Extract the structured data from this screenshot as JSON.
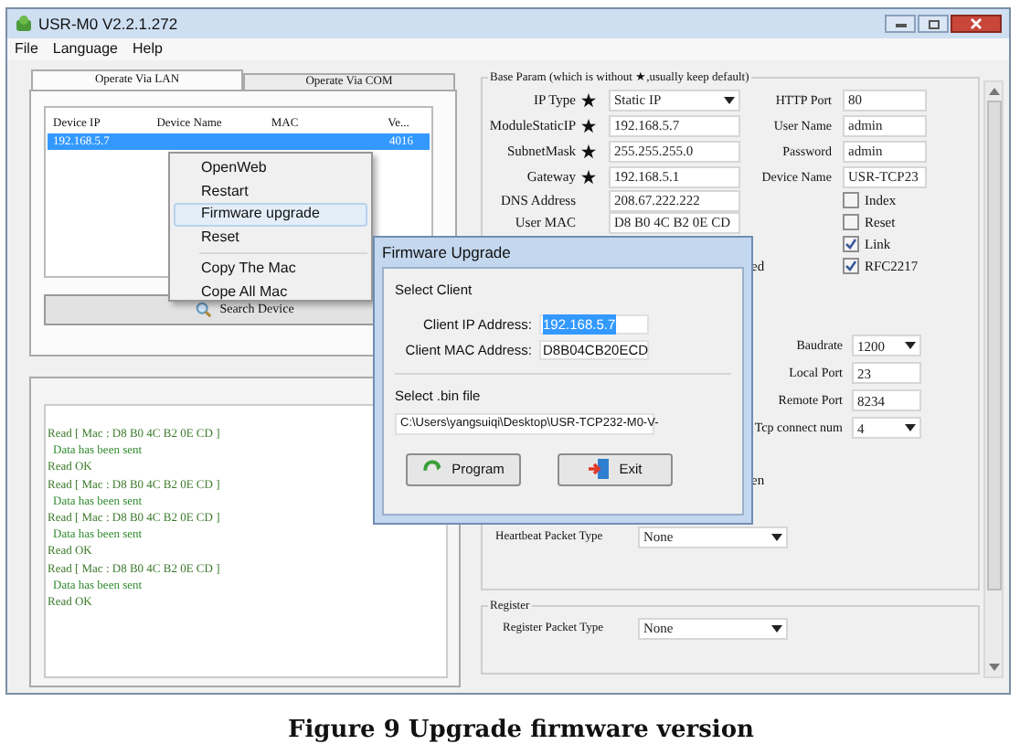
{
  "window": {
    "title": "USR-M0 V2.2.1.272"
  },
  "menu_bar": [
    "File",
    "Language",
    "Help"
  ],
  "tabs": [
    {
      "label": "Operate Via LAN",
      "selected": true
    },
    {
      "label": "Operate Via COM",
      "selected": false
    }
  ],
  "device_table": {
    "columns": [
      "Device IP",
      "Device Name",
      "MAC",
      "Ve..."
    ],
    "rows": [
      {
        "device_ip": "192.168.5.7",
        "version": "4016",
        "selected": true
      }
    ]
  },
  "search_button": "Search Device",
  "log": [
    {
      "text": "Read [ Mac : D8 B0 4C B2 0E CD ]",
      "kind": "request"
    },
    {
      "text": "Data has been sent",
      "kind": "reply"
    },
    {
      "text": "Read OK",
      "kind": "request"
    },
    {
      "text": "Read [ Mac : D8 B0 4C B2 0E CD ]",
      "kind": "request"
    },
    {
      "text": "Data has been sent",
      "kind": "reply"
    },
    {
      "text": "Read [ Mac : D8 B0 4C B2 0E CD ]",
      "kind": "request"
    },
    {
      "text": "Data has been sent",
      "kind": "reply"
    },
    {
      "text": "Read OK",
      "kind": "request"
    },
    {
      "text": "Read [ Mac : D8 B0 4C B2 0E CD ]",
      "kind": "request"
    },
    {
      "text": "Data has been sent",
      "kind": "reply"
    },
    {
      "text": "Read OK",
      "kind": "request"
    }
  ],
  "base_params": {
    "title": "Base Param (which is without ★,usually keep default)",
    "left_fields": [
      {
        "label": "IP Type",
        "required": true,
        "value": "Static IP",
        "kind": "select"
      },
      {
        "label": "ModuleStaticIP",
        "required": true,
        "value": "192.168.5.7",
        "kind": "text"
      },
      {
        "label": "SubnetMask",
        "required": true,
        "value": "255.255.255.0",
        "kind": "text"
      },
      {
        "label": "Gateway",
        "required": true,
        "value": "192.168.5.1",
        "kind": "text"
      },
      {
        "label": "DNS Address",
        "required": false,
        "value": "208.67.222.222",
        "kind": "text"
      },
      {
        "label": "User MAC",
        "required": false,
        "value": "D8 B0 4C B2 0E CD",
        "kind": "text"
      }
    ],
    "right_fields": [
      {
        "label": "HTTP Port",
        "value": "80"
      },
      {
        "label": "User Name",
        "value": "admin"
      },
      {
        "label": "Password",
        "value": "admin"
      },
      {
        "label": "Device Name",
        "value": "USR-TCP23"
      }
    ],
    "checkboxes": [
      {
        "label": "Index",
        "checked": false
      },
      {
        "label": "Reset",
        "checked": false
      },
      {
        "label": "Link",
        "checked": true
      },
      {
        "label": "RFC2217",
        "checked": true
      }
    ],
    "fragment_1": "ed",
    "serial_fields": [
      {
        "label": "Baudrate",
        "value": "1200",
        "kind": "select"
      },
      {
        "label": "Local Port",
        "value": "23",
        "kind": "text"
      },
      {
        "label": "Remote Port",
        "value": "8234",
        "kind": "text"
      },
      {
        "label": "Tcp connect num",
        "value": "4",
        "kind": "select"
      }
    ],
    "fragment_2": "en",
    "heartbeat": {
      "label": "Heartbeat Packet Type",
      "value": "None"
    }
  },
  "register": {
    "title": "Register",
    "label": "Register Packet Type",
    "value": "None"
  },
  "context_menu": [
    {
      "label": "OpenWeb",
      "selected": false,
      "separator_before": false
    },
    {
      "label": "Restart",
      "selected": false,
      "separator_before": false
    },
    {
      "label": "Firmware upgrade",
      "selected": true,
      "separator_before": false
    },
    {
      "label": "Reset",
      "selected": false,
      "separator_before": false
    },
    {
      "label": "Copy The Mac",
      "selected": false,
      "separator_before": true
    },
    {
      "label": "Cope All Mac",
      "selected": false,
      "separator_before": false
    }
  ],
  "dialog": {
    "title": "Firmware Upgrade",
    "client_section": "Select Client",
    "fields": [
      {
        "label": "Client IP Address:",
        "value": "192.168.5.7",
        "selected": true
      },
      {
        "label": "Client MAC Address:",
        "value": "D8B04CB20ECD",
        "selected": false
      }
    ],
    "file_section": "Select .bin file",
    "path": "C:\\Users\\yangsuiqi\\Desktop\\USR-TCP232-M0-V-",
    "buttons": [
      {
        "label": "Program",
        "kind": "program"
      },
      {
        "label": "Exit",
        "kind": "exit"
      }
    ]
  },
  "caption": "Figure 9 Upgrade firmware version"
}
